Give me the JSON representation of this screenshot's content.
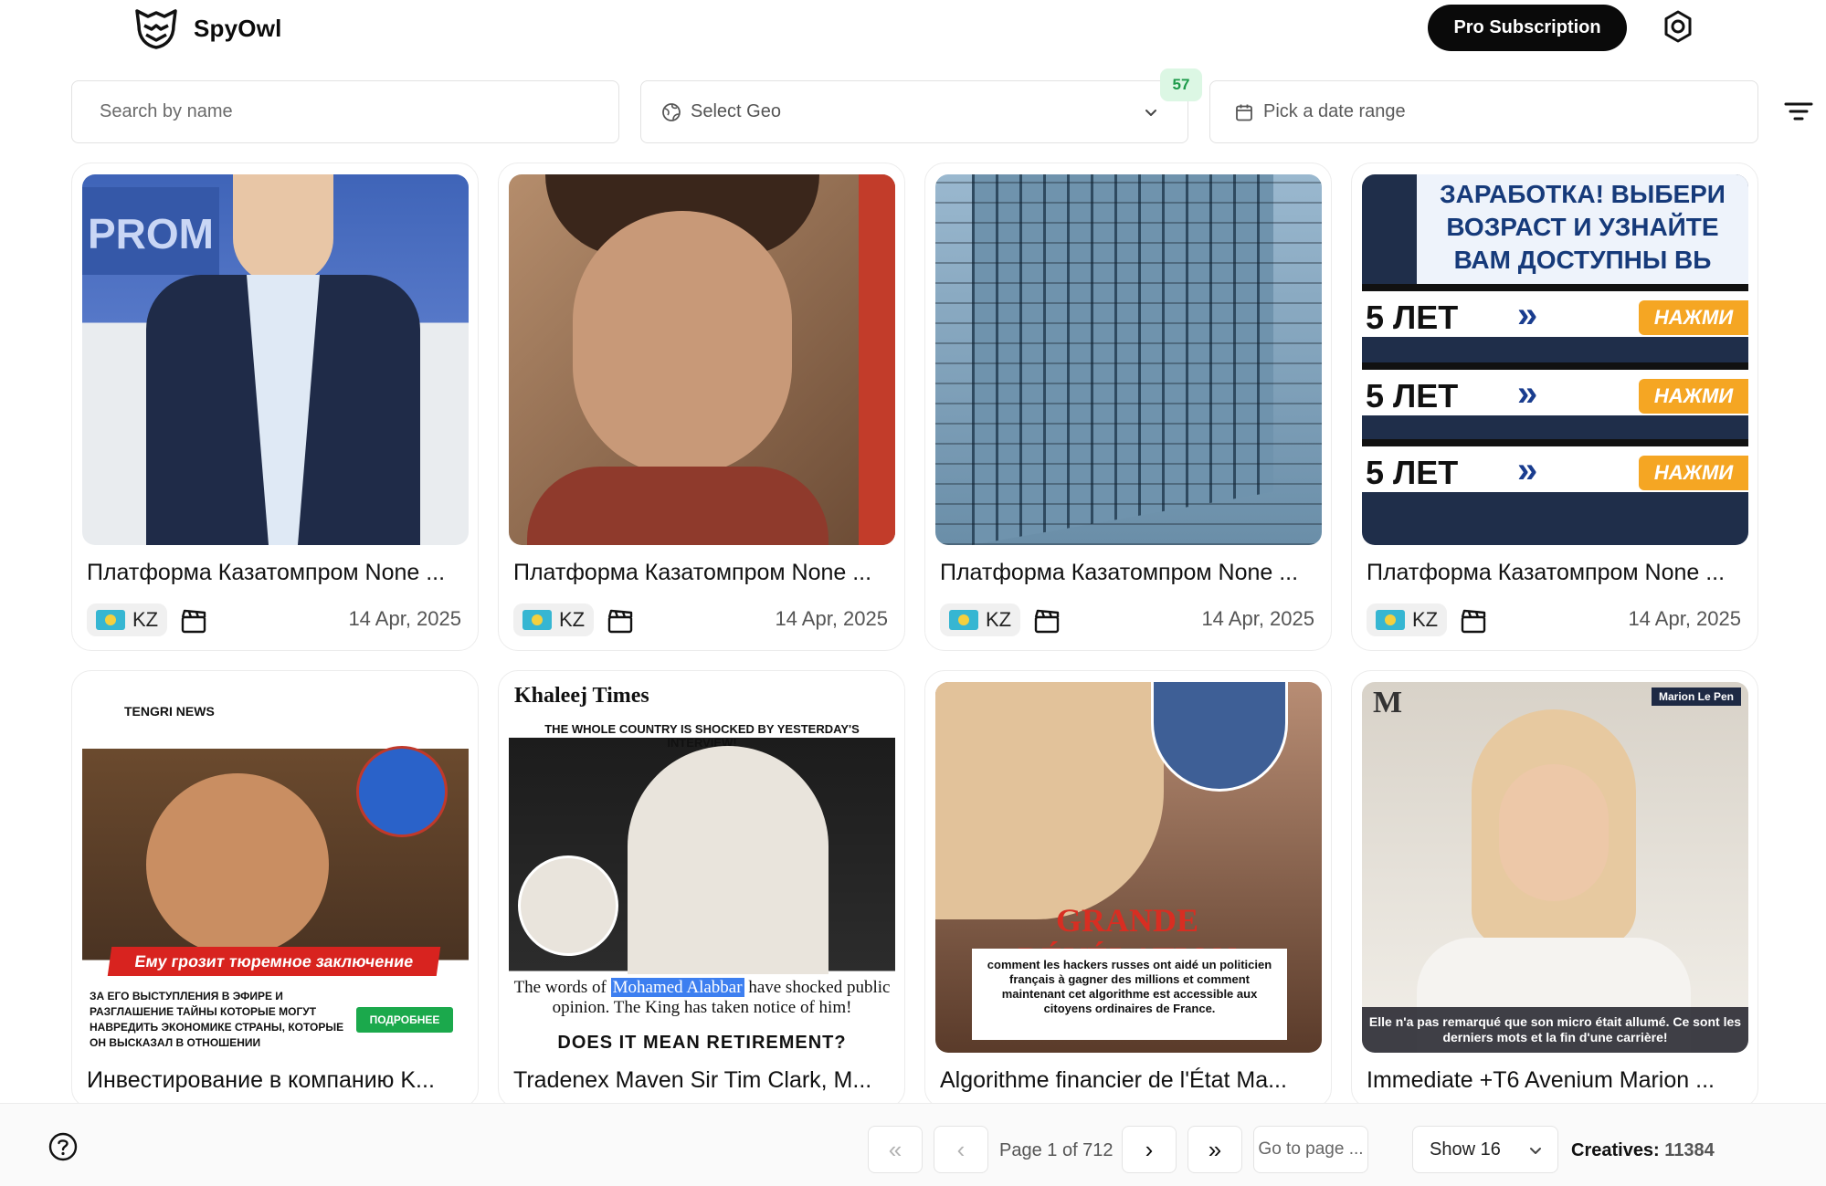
{
  "header": {
    "brand": "SpyOwl",
    "pro_button": "Pro Subscription"
  },
  "filters": {
    "search_placeholder": "Search by name",
    "geo_label": "Select Geo",
    "geo_count": "57",
    "date_label": "Pick a date range"
  },
  "cards": [
    {
      "title": "Платформа Казатомпром None ...",
      "geo": "KZ",
      "date": "14 Apr, 2025",
      "type_icon": "video-clapper-icon"
    },
    {
      "title": "Платформа Казатомпром None ...",
      "geo": "KZ",
      "date": "14 Apr, 2025",
      "type_icon": "video-clapper-icon"
    },
    {
      "title": "Платформа Казатомпром None ...",
      "geo": "KZ",
      "date": "14 Apr, 2025",
      "type_icon": "video-clapper-icon"
    },
    {
      "title": "Платформа Казатомпром None ...",
      "geo": "KZ",
      "date": "14 Apr, 2025",
      "type_icon": "video-clapper-icon"
    },
    {
      "title": "Инвестирование в компанию K...",
      "thumb_top": "TENGRI NEWS",
      "thumb_strip": "Ему грозит тюремное заключение",
      "thumb_text": "ЗА ЕГО ВЫСТУПЛЕНИЯ В ЭФИРЕ И РАЗГЛАШЕНИЕ ТАЙНЫ КОТОРЫЕ МОГУТ НАВРЕДИТЬ ЭКОНОМИКЕ СТРАНЫ, КОТОРЫЕ ОН ВЫСКАЗАЛ В ОТНОШЕНИИ ТЕЛЕВИЗИОННЫХ ВЕДУЩИХ.",
      "thumb_button": "ПОДРОБНЕЕ"
    },
    {
      "title": "Tradenex Maven Sir Tim Clark, M...",
      "thumb_top": "Khaleej Times",
      "thumb_headline": "THE WHOLE COUNTRY IS SHOCKED BY YESTERDAY'S INTERVIEW!",
      "thumb_caption_pre": "The words of",
      "thumb_caption_hl": "Mohamed Alabbar",
      "thumb_caption_post": "have shocked public opinion. The King has taken notice of him!",
      "thumb_bottom": "DOES IT MEAN RETIREMENT?"
    },
    {
      "title": "Algorithme financier de l'État Ma...",
      "thumb_headline": "GRANDE RÉVÉLATION",
      "thumb_text": "comment les hackers russes ont aidé un politicien français à gagner des millions et comment maintenant cet algorithme est accessible aux citoyens ordinaires de France."
    },
    {
      "title": "Immediate +T6 Avenium Marion ...",
      "thumb_tag": "Marion Le Pen",
      "thumb_caption": "Elle n'a pas remarqué que son micro était allumé. Ce sont les derniers mots et la fin d'une carrière!"
    }
  ],
  "card4_thumb": {
    "banner": "ЗАРАБОТКА! ВЫБЕРИ ВОЗРАСТ И УЗНАЙТЕ ВАМ ДОСТУПНЫ ВЬ",
    "rows": [
      "5 ЛЕТ",
      "5 ЛЕТ",
      "5 ЛЕТ"
    ],
    "button": "НАЖМИ"
  },
  "card1_thumb": {
    "backdrop": "PROM"
  },
  "pagination": {
    "page_text": "Page 1 of 712",
    "goto_label": "Go to page ...",
    "show_label": "Show 16",
    "creatives_label": "Creatives:",
    "creatives_count": "11384"
  },
  "colors": {
    "accent": "#0a0a0a",
    "geo_badge_bg": "#dcf7e4",
    "geo_badge_text": "#1d9a4a"
  }
}
